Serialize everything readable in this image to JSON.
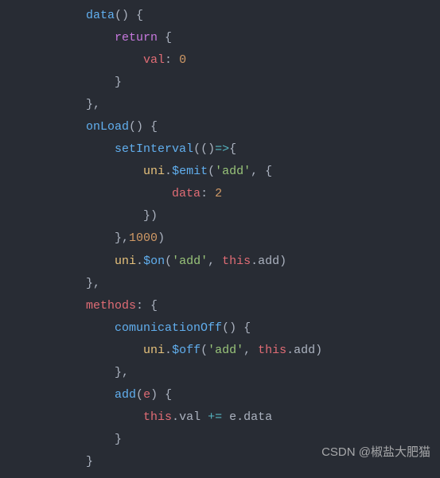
{
  "code": {
    "lines": [
      {
        "indent": 3,
        "tokens": [
          {
            "t": "function",
            "v": "data"
          },
          {
            "t": "punctuation",
            "v": "() {"
          }
        ]
      },
      {
        "indent": 4,
        "tokens": [
          {
            "t": "keyword",
            "v": "return"
          },
          {
            "t": "punctuation",
            "v": " {"
          }
        ]
      },
      {
        "indent": 5,
        "tokens": [
          {
            "t": "property",
            "v": "val"
          },
          {
            "t": "punctuation",
            "v": ": "
          },
          {
            "t": "number",
            "v": "0"
          }
        ]
      },
      {
        "indent": 4,
        "tokens": [
          {
            "t": "punctuation",
            "v": "}"
          }
        ]
      },
      {
        "indent": 3,
        "tokens": [
          {
            "t": "punctuation",
            "v": "},"
          }
        ]
      },
      {
        "indent": 3,
        "tokens": [
          {
            "t": "function",
            "v": "onLoad"
          },
          {
            "t": "punctuation",
            "v": "() {"
          }
        ]
      },
      {
        "indent": 4,
        "tokens": [
          {
            "t": "function",
            "v": "setInterval"
          },
          {
            "t": "punctuation",
            "v": "(()"
          },
          {
            "t": "operator",
            "v": "=>"
          },
          {
            "t": "punctuation",
            "v": "{"
          }
        ]
      },
      {
        "indent": 5,
        "tokens": [
          {
            "t": "variable",
            "v": "uni"
          },
          {
            "t": "punctuation",
            "v": "."
          },
          {
            "t": "function",
            "v": "$emit"
          },
          {
            "t": "punctuation",
            "v": "("
          },
          {
            "t": "string",
            "v": "'add'"
          },
          {
            "t": "punctuation",
            "v": ", {"
          }
        ]
      },
      {
        "indent": 6,
        "tokens": [
          {
            "t": "property",
            "v": "data"
          },
          {
            "t": "punctuation",
            "v": ": "
          },
          {
            "t": "number",
            "v": "2"
          }
        ]
      },
      {
        "indent": 5,
        "tokens": [
          {
            "t": "punctuation",
            "v": "})"
          }
        ]
      },
      {
        "indent": 4,
        "tokens": [
          {
            "t": "punctuation",
            "v": "},"
          },
          {
            "t": "number",
            "v": "1000"
          },
          {
            "t": "punctuation",
            "v": ")"
          }
        ]
      },
      {
        "indent": 4,
        "tokens": [
          {
            "t": "variable",
            "v": "uni"
          },
          {
            "t": "punctuation",
            "v": "."
          },
          {
            "t": "function",
            "v": "$on"
          },
          {
            "t": "punctuation",
            "v": "("
          },
          {
            "t": "string",
            "v": "'add'"
          },
          {
            "t": "punctuation",
            "v": ", "
          },
          {
            "t": "thiskw",
            "v": "this"
          },
          {
            "t": "punctuation",
            "v": "."
          },
          {
            "t": "plain",
            "v": "add)"
          }
        ]
      },
      {
        "indent": 3,
        "tokens": [
          {
            "t": "punctuation",
            "v": "},"
          }
        ]
      },
      {
        "indent": 3,
        "tokens": [
          {
            "t": "property",
            "v": "methods"
          },
          {
            "t": "punctuation",
            "v": ": {"
          }
        ]
      },
      {
        "indent": 4,
        "tokens": [
          {
            "t": "function",
            "v": "comunicationOff"
          },
          {
            "t": "punctuation",
            "v": "() {"
          }
        ]
      },
      {
        "indent": 5,
        "tokens": [
          {
            "t": "variable",
            "v": "uni"
          },
          {
            "t": "punctuation",
            "v": "."
          },
          {
            "t": "function",
            "v": "$off"
          },
          {
            "t": "punctuation",
            "v": "("
          },
          {
            "t": "string",
            "v": "'add'"
          },
          {
            "t": "punctuation",
            "v": ", "
          },
          {
            "t": "thiskw",
            "v": "this"
          },
          {
            "t": "punctuation",
            "v": "."
          },
          {
            "t": "plain",
            "v": "add)"
          }
        ]
      },
      {
        "indent": 4,
        "tokens": [
          {
            "t": "punctuation",
            "v": "},"
          }
        ]
      },
      {
        "indent": 4,
        "tokens": [
          {
            "t": "function",
            "v": "add"
          },
          {
            "t": "punctuation",
            "v": "("
          },
          {
            "t": "param",
            "v": "e"
          },
          {
            "t": "punctuation",
            "v": ") {"
          }
        ]
      },
      {
        "indent": 5,
        "tokens": [
          {
            "t": "thiskw",
            "v": "this"
          },
          {
            "t": "punctuation",
            "v": "."
          },
          {
            "t": "plain",
            "v": "val "
          },
          {
            "t": "operator",
            "v": "+="
          },
          {
            "t": "plain",
            "v": " e."
          },
          {
            "t": "plain",
            "v": "data"
          }
        ]
      },
      {
        "indent": 4,
        "tokens": [
          {
            "t": "punctuation",
            "v": "}"
          }
        ]
      },
      {
        "indent": 3,
        "tokens": [
          {
            "t": "punctuation",
            "v": "}"
          }
        ]
      }
    ]
  },
  "watermark": "CSDN @椒盐大肥猫",
  "indentUnit": "    "
}
